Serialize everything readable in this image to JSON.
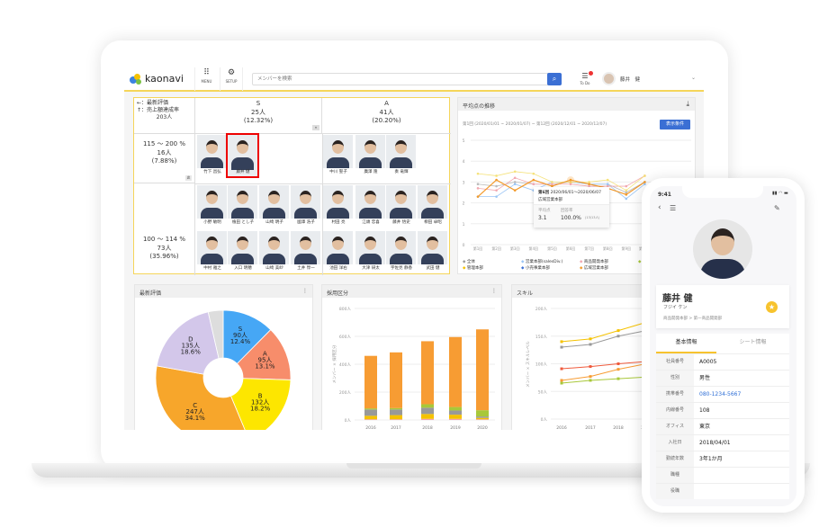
{
  "header": {
    "logo": "kaonavi",
    "menu_label": "MENU",
    "setup_label": "SETUP",
    "search_placeholder": "メンバーを検索",
    "todo_label": "To Do",
    "user_name": "藤井　健"
  },
  "grid": {
    "legend": [
      "←：最新評価",
      "↑：売上額達成率",
      "203人"
    ],
    "columns": [
      {
        "grade": "S",
        "count": "25人",
        "pct": "(12.32%)"
      },
      {
        "grade": "A",
        "count": "41人",
        "pct": "(20.20%)"
      }
    ],
    "rows": [
      {
        "range": "115 ～ 200 %",
        "count": "16人",
        "pct": "(7.88%)"
      },
      {
        "range": "100 ～ 114 %",
        "count": "73人",
        "pct": "(35.96%)"
      }
    ],
    "cells": {
      "r1_s": [
        "竹下 昌弘",
        "藤井 健"
      ],
      "r1_a": [
        "中川 聖子",
        "廣澤 隆",
        "奏 竜輝"
      ],
      "r2_s": [
        "小野 敏明",
        "植田 とし子",
        "山崎 明子",
        "國澤 浩子",
        "中村 雅之",
        "入口 明穂",
        "山崎 美紗",
        "土井 惇一"
      ],
      "r2_a": [
        "村田 亮",
        "江頭 忠喜",
        "藤井 悟史",
        "柳田 卓昭",
        "池田 洋右",
        "大津 研太",
        "宇佐見 静香",
        "武田 健"
      ]
    },
    "selected": "藤井 健",
    "more_badge": "炎"
  },
  "trend": {
    "title": "平均点の推移",
    "range": "第1回 (2020/01/01 ~ 2020/01/07) ~ 第12回 (2020/12/01 ~ 2020/12/07)",
    "button": "表示条件",
    "tooltip": {
      "round": "第6回",
      "dates": "2020/06/01～2020/06/07",
      "dept": "広域営業本部",
      "avg_label": "平均点",
      "avg": "3.1",
      "rate_label": "回答率",
      "rate": "100.0%",
      "rate_note": "(13/13人)"
    },
    "legend": [
      "全体",
      "営業本部(salesDiv.)",
      "商品開発本部",
      "海外",
      "管理本部",
      "小売事業本部",
      "広域営業本部"
    ]
  },
  "pie": {
    "title": "最新評価"
  },
  "bars": {
    "title": "採用区分"
  },
  "skill": {
    "title": "スキル"
  },
  "chart_data": [
    {
      "type": "line",
      "title": "平均点の推移",
      "x": [
        "第1回",
        "第2回",
        "第3回",
        "第4回",
        "第5回",
        "第6回",
        "第7回",
        "第8回",
        "第9回",
        "第10回"
      ],
      "ylim": [
        0,
        5
      ],
      "yticks": [
        "0",
        "1",
        "2",
        "3",
        "4",
        "5"
      ],
      "grid": true,
      "legend": "bottom",
      "series": [
        {
          "name": "広域営業本部",
          "color": "#f39a2b",
          "values": [
            2.3,
            3.1,
            2.6,
            3.1,
            2.8,
            3.1,
            2.9,
            2.7,
            2.4,
            3.0
          ]
        },
        {
          "name": "管理本部",
          "color": "#f5e27a",
          "values": [
            3.4,
            3.3,
            3.5,
            3.4,
            3.0,
            3.0,
            3.0,
            3.1,
            2.6,
            3.3
          ]
        },
        {
          "name": "商品開発本部",
          "color": "#f2a8b0",
          "values": [
            2.7,
            2.6,
            3.2,
            2.9,
            2.9,
            2.9,
            2.8,
            2.8,
            2.8,
            3.3
          ]
        },
        {
          "name": "営業本部(salesDiv.)",
          "color": "#9cc6f5",
          "values": [
            2.3,
            2.3,
            2.9,
            2.6,
            3.0,
            3.0,
            2.9,
            2.9,
            2.2,
            2.9
          ]
        },
        {
          "name": "全体",
          "color": "#bbbbbb",
          "values": [
            2.9,
            2.8,
            3.0,
            2.9,
            2.9,
            3.0,
            2.9,
            2.9,
            2.5,
            3.0
          ]
        }
      ]
    },
    {
      "type": "pie",
      "title": "最新評価",
      "donut": true,
      "slices": [
        {
          "label": "S",
          "count": "90人",
          "pct": "12.4%",
          "value": 90,
          "color": "#46a7f5"
        },
        {
          "label": "A",
          "count": "95人",
          "pct": "13.1%",
          "value": 95,
          "color": "#f78d6b"
        },
        {
          "label": "B",
          "count": "132人",
          "pct": "18.2%",
          "value": 132,
          "color": "#fde600"
        },
        {
          "label": "C",
          "count": "247人",
          "pct": "34.1%",
          "value": 247,
          "color": "#f7a62b"
        },
        {
          "label": "D",
          "count": "135人",
          "pct": "18.6%",
          "value": 135,
          "color": "#d3c7ea"
        },
        {
          "label": "",
          "count": "",
          "pct": "",
          "value": 26,
          "color": "#dddddd"
        }
      ]
    },
    {
      "type": "bar",
      "stacked": true,
      "title": "採用区分",
      "ylabel": "メンバー × 採用区分",
      "categories": [
        "2016",
        "2017",
        "2018",
        "2019",
        "2020"
      ],
      "ylim": [
        0,
        800
      ],
      "yticks": [
        "0人",
        "200人",
        "400人",
        "600人",
        "800人"
      ],
      "grid": true,
      "series": [
        {
          "color": "#f2a2b0",
          "values": [
            5,
            5,
            8,
            8,
            5
          ]
        },
        {
          "color": "#f5c200",
          "values": [
            25,
            30,
            35,
            30,
            10
          ]
        },
        {
          "color": "#999999",
          "values": [
            45,
            40,
            45,
            30,
            10
          ]
        },
        {
          "color": "#a8c83a",
          "values": [
            8,
            10,
            25,
            25,
            45
          ]
        },
        {
          "color": "#f79c33",
          "values": [
            377,
            400,
            452,
            502,
            580
          ]
        }
      ]
    },
    {
      "type": "line",
      "title": "スキル",
      "ylabel": "メンバー × スキルレベル",
      "categories": [
        "2016",
        "2017",
        "2018",
        "2019"
      ],
      "ylim": [
        0,
        200
      ],
      "yticks": [
        "0人",
        "50人",
        "100人",
        "150人",
        "200人"
      ],
      "grid": true,
      "series": [
        {
          "color": "#f5c200",
          "values": [
            140,
            145,
            160,
            175
          ]
        },
        {
          "color": "#999999",
          "values": [
            130,
            135,
            150,
            160
          ]
        },
        {
          "color": "#ef5a3c",
          "values": [
            91,
            95,
            100,
            104
          ]
        },
        {
          "color": "#f79c33",
          "values": [
            70,
            77,
            90,
            100
          ]
        },
        {
          "color": "#a8c83a",
          "values": [
            65,
            70,
            73,
            76
          ]
        }
      ]
    }
  ],
  "phone": {
    "time": "9:41",
    "name": "藤井 健",
    "kana": "フジイ ケン",
    "dept": "商品開発本部 > 第一商品開発部",
    "tabs": [
      "基本情報",
      "シート情報"
    ],
    "fields": [
      {
        "k": "社員番号",
        "v": "A0005"
      },
      {
        "k": "性別",
        "v": "男性"
      },
      {
        "k": "携帯番号",
        "v": "080-1234-5667"
      },
      {
        "k": "内線番号",
        "v": "108"
      },
      {
        "k": "オフィス",
        "v": "東京"
      },
      {
        "k": "入社日",
        "v": "2018/04/01"
      },
      {
        "k": "勤続年数",
        "v": "3年1か月"
      },
      {
        "k": "職種",
        "v": ""
      },
      {
        "k": "役職",
        "v": ""
      }
    ]
  },
  "colors": {
    "accent": "#f5d55a",
    "primary": "#3b6fd4",
    "link": "#2f6fd6",
    "star": "#f7c32e"
  }
}
